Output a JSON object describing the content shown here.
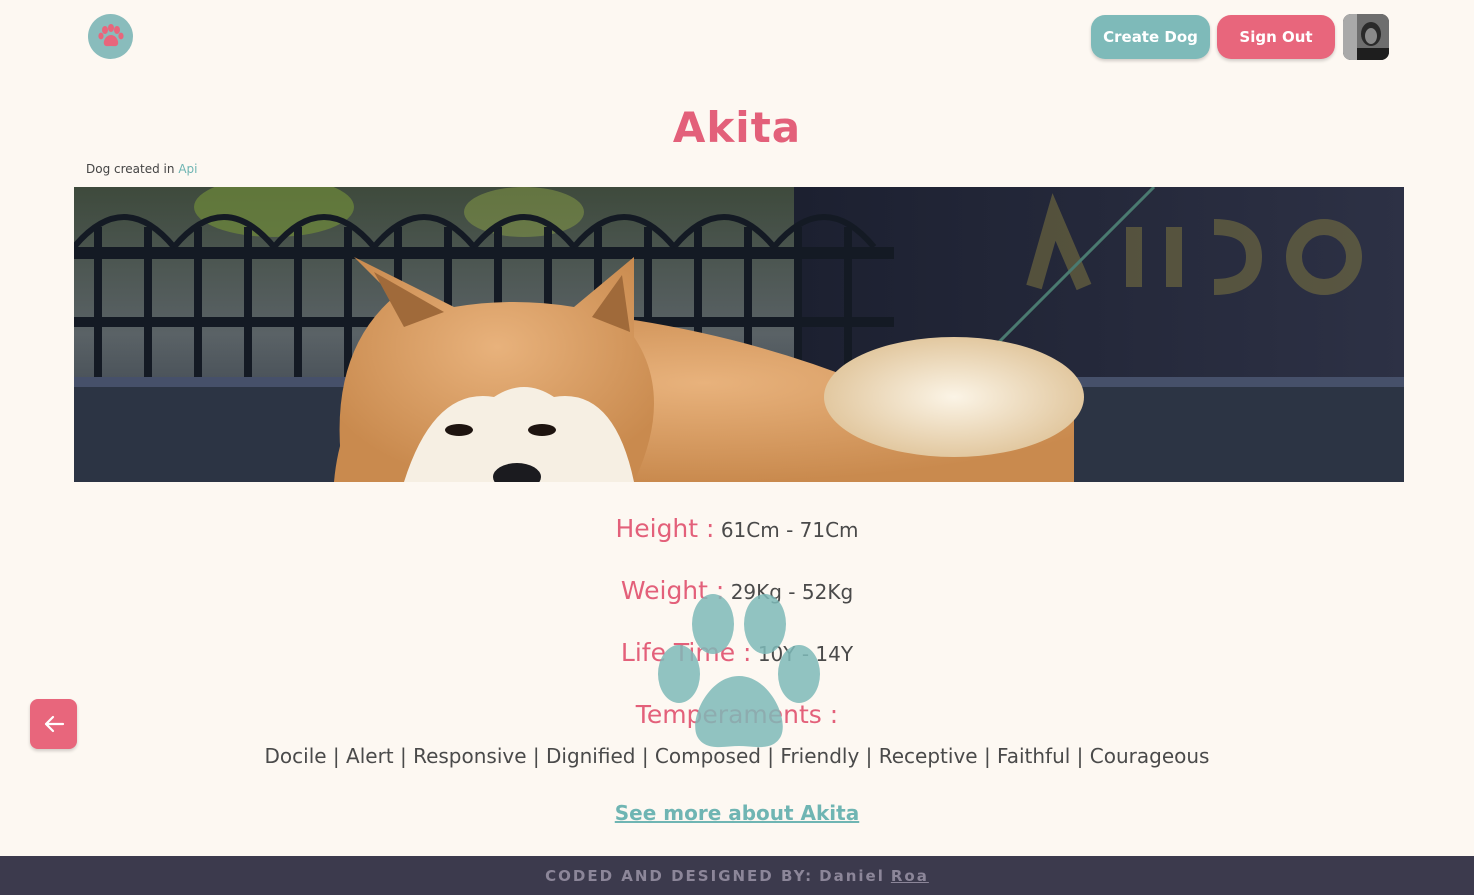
{
  "header": {
    "logo_icon": "paw-icon",
    "create_label": "Create Dog",
    "signout_label": "Sign Out"
  },
  "dog": {
    "name": "Akita",
    "created_prefix": "Dog created in",
    "created_source": "Api",
    "height_label": "Height :",
    "height_value": "61Cm - 71Cm",
    "weight_label": "Weight :",
    "weight_value": "29Kg - 52Kg",
    "life_label": "Life Time :",
    "life_value": "10Y - 14Y",
    "temperaments_label": "Temperaments :",
    "temperaments": "Docile | Alert | Responsive | Dignified | Composed | Friendly | Receptive | Faithful | Courageous",
    "more_link": "See more about Akita"
  },
  "footer": {
    "credit_prefix": "CODED AND DESIGNED BY:",
    "author_first": "Daniel",
    "author_last": "Roa"
  },
  "colors": {
    "accent_pink": "#e3607a",
    "accent_teal": "#7ebab9",
    "background": "#fdf8f2",
    "footer_bg": "#3c3a4d"
  }
}
